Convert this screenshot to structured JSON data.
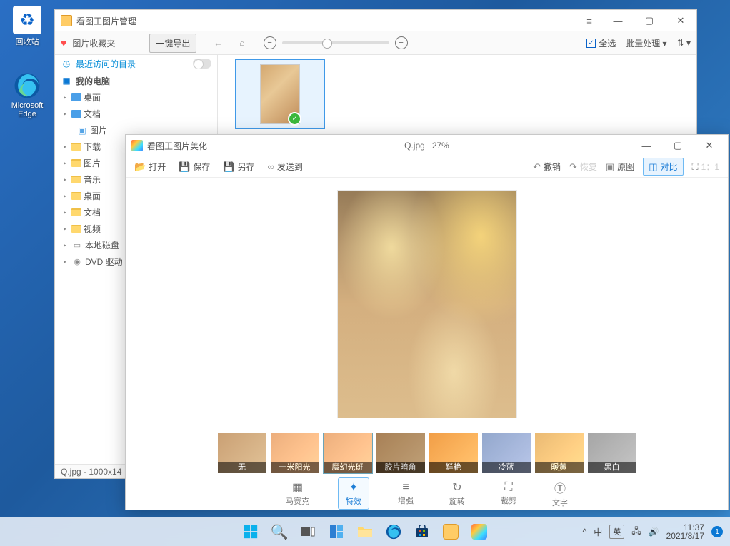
{
  "desktop": {
    "recycle_bin": "回收站",
    "edge": "Microsoft Edge"
  },
  "fm": {
    "title": "看图王图片管理",
    "fav_label": "图片收藏夹",
    "export_btn": "一键导出",
    "recent_label": "最近访问的目录",
    "computer_label": "我的电脑",
    "select_all": "全选",
    "batch": "批量处理",
    "tree": {
      "desktop1": "桌面",
      "doc1": "文档",
      "pic1": "图片",
      "download": "下载",
      "pic2": "图片",
      "music": "音乐",
      "desktop2": "桌面",
      "doc2": "文档",
      "video": "视频",
      "disk": "本地磁盘",
      "dvd": "DVD 驱动"
    },
    "status": "Q.jpg - 1000x14"
  },
  "editor": {
    "title": "看图王图片美化",
    "file_name": "Q.jpg",
    "zoom": "27%",
    "open": "打开",
    "save": "保存",
    "saveas": "另存",
    "sendto": "发送到",
    "undo": "撤销",
    "redo": "恢复",
    "original": "原图",
    "compare": "对比",
    "ratio": "1：1",
    "filters": {
      "none": "无",
      "sun": "一米阳光",
      "magic": "魔幻光斑",
      "film": "胶片暗角",
      "vivid": "鲜艳",
      "cool": "冷蓝",
      "warm": "暖黄",
      "bw": "黑白"
    },
    "tools": {
      "mosaic": "马赛克",
      "effect": "特效",
      "enhance": "增强",
      "rotate": "旋转",
      "crop": "裁剪",
      "text": "文字"
    }
  },
  "taskbar": {
    "weather": "^",
    "ime1": "中",
    "ime2": "英",
    "time": "11:37",
    "date": "2021/8/17",
    "noti_count": "1"
  }
}
